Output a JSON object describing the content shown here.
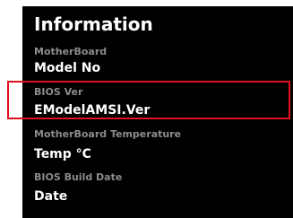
{
  "panel": {
    "title": "Information",
    "rows": [
      {
        "label": "MotherBoard",
        "value": "Model No"
      },
      {
        "label": "BIOS Ver",
        "value": "EModelAMSI.Ver"
      },
      {
        "label": "MotherBoard Temperature",
        "value": "Temp °C"
      },
      {
        "label": "BIOS Build Date",
        "value": "Date"
      }
    ]
  },
  "colors": {
    "background": "#000000",
    "label_gray": "#8c8c8c",
    "value_white": "#ffffff",
    "highlight_red": "#e0101e"
  }
}
